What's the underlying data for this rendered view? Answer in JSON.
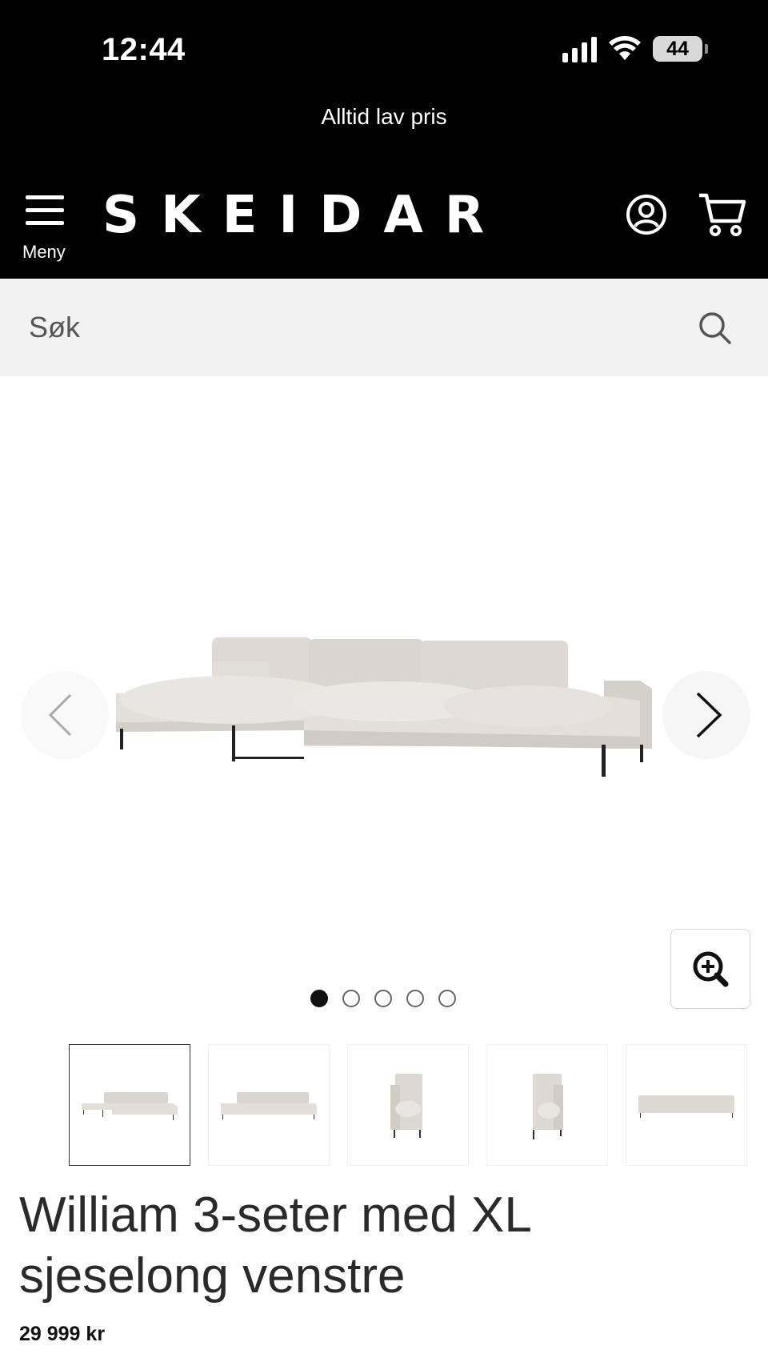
{
  "status": {
    "time": "12:44",
    "battery": "44"
  },
  "header": {
    "promo": "Alltid lav pris",
    "menu_label": "Meny",
    "logo": "SKEIDAR"
  },
  "search": {
    "placeholder": "Søk"
  },
  "gallery": {
    "dots_count": 5,
    "active_dot": 1,
    "thumbnails": [
      "sofa-chaise-left-angle",
      "sofa-chaise-left-front",
      "sofa-side-view",
      "sofa-side-view-2",
      "sofa-back-view"
    ],
    "active_thumb": 1
  },
  "product": {
    "title": "William 3-seter med XL sjeselong venstre",
    "price": "29 999 kr"
  },
  "colors": {
    "header_bg": "#000000",
    "search_bg": "#f2f2f2",
    "sofa_fabric": "#dcd9d3"
  }
}
